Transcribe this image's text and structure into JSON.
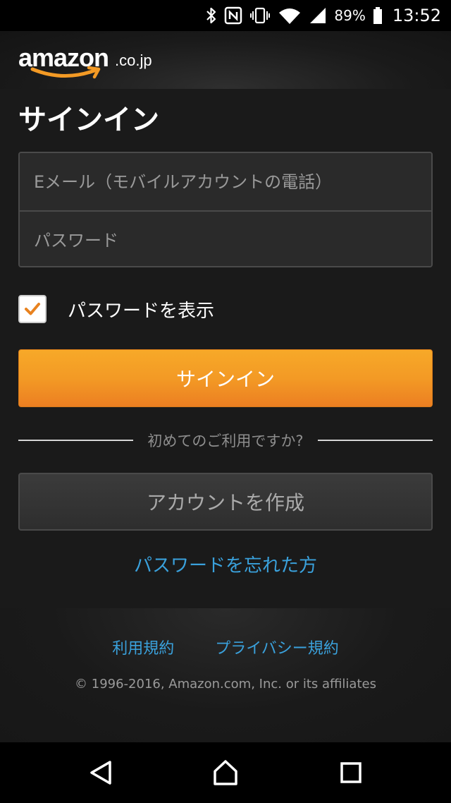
{
  "status_bar": {
    "battery_percent": "89%",
    "time": "13:52"
  },
  "header": {
    "logo_word": "amazon",
    "logo_tld": ".co.jp"
  },
  "page": {
    "title": "サインイン"
  },
  "form": {
    "email_placeholder": "Eメール（モバイルアカウントの電話）",
    "password_placeholder": "パスワード",
    "show_password_label": "パスワードを表示",
    "show_password_checked": true,
    "signin_label": "サインイン",
    "first_time_text": "初めてのご利用ですか?",
    "create_account_label": "アカウントを作成",
    "forgot_password_link": "パスワードを忘れた方"
  },
  "footer": {
    "terms_link": "利用規約",
    "privacy_link": "プライバシー規約",
    "copyright": "© 1996-2016, Amazon.com, Inc. or its affiliates"
  },
  "colors": {
    "accent_orange": "#f39a25",
    "link_blue": "#3aa1dc",
    "background": "#1a1a1a",
    "check_orange": "#e8821f"
  },
  "icons": {
    "status": [
      "bluetooth-icon",
      "nfc-icon",
      "vibrate-icon",
      "wifi-icon",
      "signal-icon",
      "battery-icon"
    ],
    "nav": [
      "back-icon",
      "home-icon",
      "recents-icon"
    ]
  }
}
